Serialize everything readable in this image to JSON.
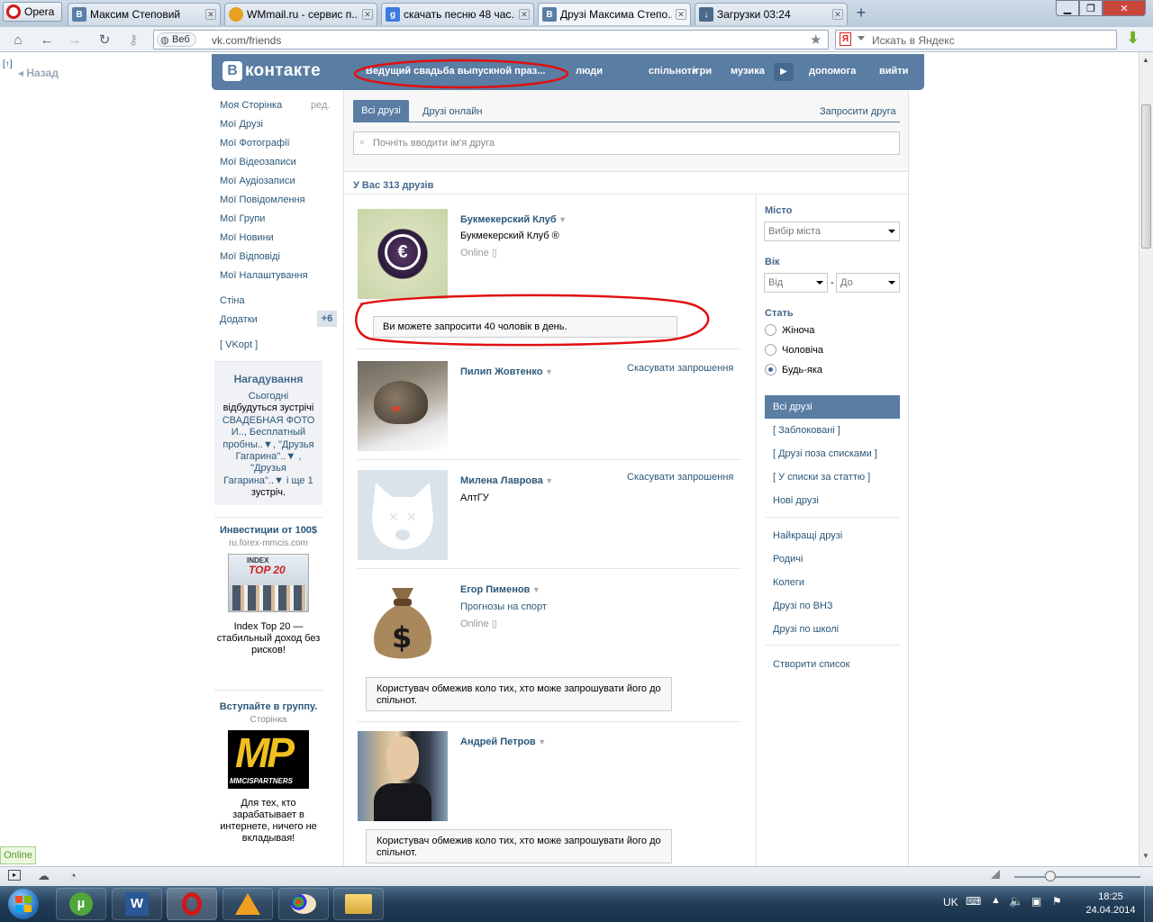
{
  "browser": {
    "menu_label": "Opera",
    "tabs": [
      {
        "title": "Максим Степовий",
        "icon": "vk-icon",
        "color": "#5a7fa6"
      },
      {
        "title": "WMmail.ru - сервис п...",
        "icon": "wmmail-icon",
        "color": "#e8a020"
      },
      {
        "title": "скачать песню 48 час...",
        "icon": "google-icon",
        "color": "#3c7be0"
      },
      {
        "title": "Друзі Максима Степо...",
        "icon": "vk-icon",
        "color": "#5a7fa6"
      },
      {
        "title": "Загрузки 03:24",
        "icon": "downloads-icon",
        "color": "#4b6a8a"
      }
    ],
    "web_label": "Веб",
    "url": "vk.com/friends",
    "search_placeholder": "Искать в Яндекс",
    "back_label": "Назад"
  },
  "vk": {
    "logo": "ВКонтакте",
    "status_text": "Ведущий свадьба выпускной праз...",
    "menu": [
      "люди",
      "спільноти",
      "ігри",
      "музика",
      "допомога",
      "вийти"
    ],
    "left_nav": [
      "Моя Сторінка",
      "Мої Друзі",
      "Мої Фотографії",
      "Мої Відеозаписи",
      "Мої Аудіозаписи",
      "Мої Повідомлення",
      "Мої Групи",
      "Мої Новини",
      "Мої Відповіді",
      "Мої Налаштування"
    ],
    "edit_label": "ред.",
    "wall_label": "Стіна",
    "apps_label": "Додатки",
    "apps_badge": "+6",
    "vkopt_label": "[ VKopt ]",
    "reminder": {
      "title": "Нагадування",
      "lines": [
        "Сьогодні",
        "відбудуться зустрічі",
        "СВАДЕБНАЯ ФОТО",
        "И.., Бесплатный",
        "пробны..▼, \"Друзья",
        "Гагарина\"..▼ ,",
        "\"Друзья",
        "Гагарина\"..▼ і ще 1",
        "зустріч."
      ]
    },
    "ads": [
      {
        "title": "Инвестиции от 100$",
        "domain": "ru.forex-mmcis.com",
        "image_text_1": "INDEX",
        "image_text_2": "TOP 20",
        "text": "Index Top 20 — стабильный доход без рисков!"
      },
      {
        "title": "Вступайте в группу.",
        "domain": "Сторінка",
        "image_text_1": "MP",
        "image_text_2": "MMCISPARTNERS",
        "text": "Для тех, кто зарабатывает в интернете, ничего не вкладывая!"
      }
    ],
    "tabs": {
      "all": "Всі друзі",
      "online": "Друзі онлайн",
      "invite": "Запросити друга"
    },
    "search_placeholder": "Почніть вводити ім'я друга",
    "count_text": "У Вас 313 друзів",
    "friends": [
      {
        "name": "Букмекерский Клуб",
        "sub": "Букмекерский Клуб ®",
        "online": "Online",
        "action": ""
      },
      {
        "name": "Пилип Жовтенко",
        "sub": "",
        "online": "",
        "action": "Скасувати запрошення"
      },
      {
        "name": "Милена Лаврова",
        "sub": "АлтГУ",
        "online": "",
        "action": "Скасувати запрошення"
      },
      {
        "name": "Егор Пименов",
        "sub": "Прогнозы на спорт",
        "online": "Online",
        "action": ""
      },
      {
        "name": "Андрей Петров",
        "sub": "",
        "online": "",
        "action": ""
      }
    ],
    "notice_invite": "Ви можете запросити 40 чоловік в день.",
    "notice_restricted": "Користувач обмежив коло тих, хто може запрошувати його до спільнот.",
    "filters": {
      "city_label": "Місто",
      "city_value": "Вибір міста",
      "age_label": "Вік",
      "age_from": "Від",
      "age_dash": "-",
      "age_to": "До",
      "gender_label": "Стать",
      "genders": [
        "Жіноча",
        "Чоловіча",
        "Будь-яка"
      ],
      "selected_gender": "Будь-яка"
    },
    "lists": {
      "all": "Всі друзі",
      "group1": [
        "[ Заблоковані ]",
        "[ Друзі поза списками ]",
        "[ У списки за статтю ]",
        "Нові друзі"
      ],
      "group2": [
        "Найкращі друзі",
        "Родичі",
        "Колеги",
        "Друзі по ВНЗ",
        "Друзі по школі"
      ],
      "create": "Створити список"
    }
  },
  "status": {
    "online_label": "Online"
  },
  "taskbar": {
    "lang": "UK",
    "time": "18:25",
    "date": "24.04.2014"
  },
  "colors": {
    "vk_blue": "#597da3",
    "link": "#2b587a",
    "annotation": "#e01010"
  }
}
